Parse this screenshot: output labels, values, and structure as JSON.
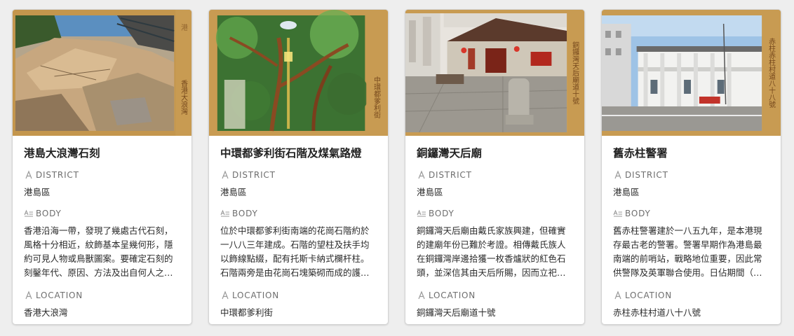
{
  "labels": {
    "district": "DISTRICT",
    "body": "BODY",
    "location": "LOCATION"
  },
  "icons": {
    "district": "text-a-icon",
    "body": "multiline-text-icon",
    "location": "text-a-icon"
  },
  "cards": [
    {
      "title": "港島大浪灣石刻",
      "district": "港島區",
      "body": "香港沿海一帶，發現了幾處古代石刻，風格十分相近，紋飾基本呈幾何形，隱約可見人物或鳥獸圖案。要確定石刻的刻鑿年代、原因、方法及出自何人之…",
      "location": "香港大浪灣",
      "cover_caption": "香港大浪灣"
    },
    {
      "title": "中環都爹利街石階及煤氣路燈",
      "district": "港島區",
      "body": "位於中環都爹利街南端的花崗石階約於一八八三年建成。石階的望柱及扶手均以飾線點綴，配有托斯卡納式欄杆柱。石階兩旁是由花崗石塊築砌而成的護…",
      "location": "中環都爹利街",
      "cover_caption": "中環都爹利街"
    },
    {
      "title": "銅鑼灣天后廟",
      "district": "港島區",
      "body": "銅鑼灣天后廟由戴氏家族興建，但確實的建廟年份已難於考證。相傳戴氏族人在銅鑼灣岸邊拾獲一枚香爐狀的紅色石頭，並深信其由天后所賜，因而立祀…",
      "location": "銅鑼灣天后廟道十號",
      "cover_caption": "銅鑼灣天后廟道十號"
    },
    {
      "title": "舊赤柱警署",
      "district": "港島區",
      "body": "舊赤柱警署建於一八五九年，是本港現存最古老的警署。警署早期作為港島最南端的前哨站，戰略地位重要，因此常供警隊及英軍聯合使用。日佔期間（…",
      "location": "赤柱赤柱村道八十八號",
      "cover_caption": "赤柱赤柱村道八十八號"
    }
  ]
}
